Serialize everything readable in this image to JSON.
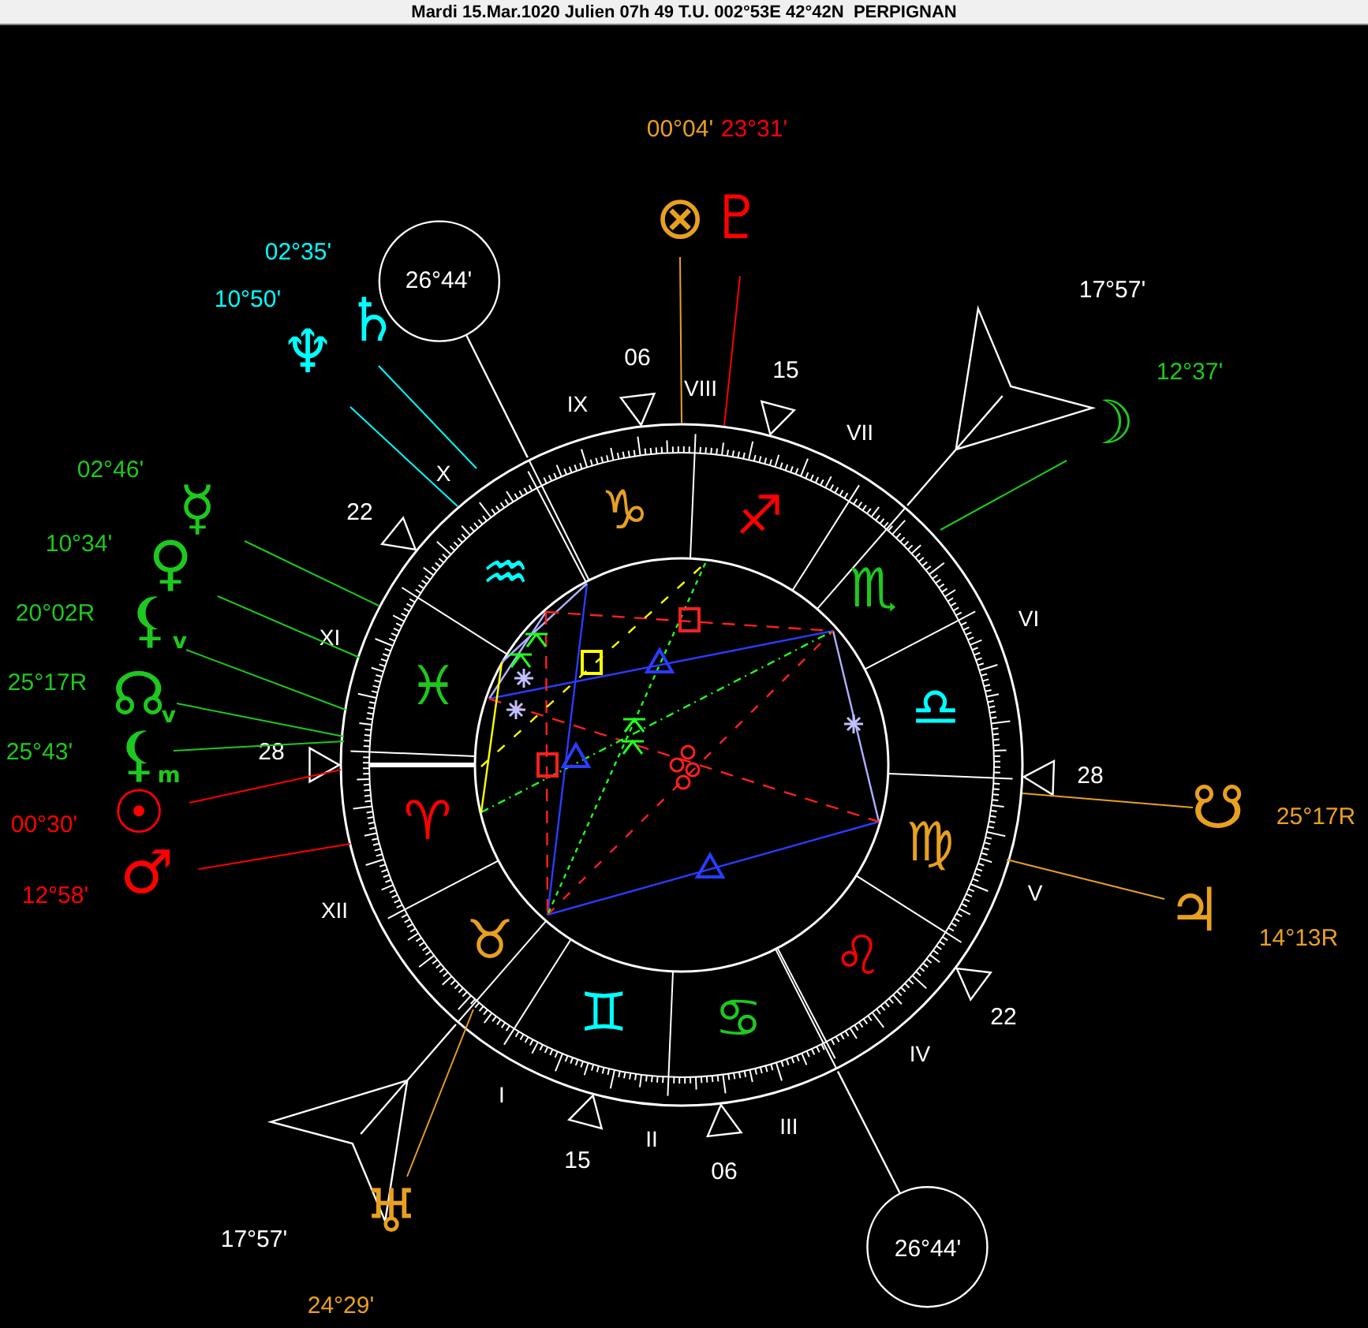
{
  "title_bar": {
    "title": "Mardi 15.Mar.1020 Julien 07h 49 T.U. 002°53E 42°42N  PERPIGNAN"
  },
  "zodiac_signs": [
    {
      "glyph": "♈",
      "color": "#ff0000"
    },
    {
      "glyph": "♉",
      "color": "#e8a020"
    },
    {
      "glyph": "♊",
      "color": "#00ffff"
    },
    {
      "glyph": "♋",
      "color": "#1ec81e"
    },
    {
      "glyph": "♌",
      "color": "#ff0000"
    },
    {
      "glyph": "♍",
      "color": "#e8a020"
    },
    {
      "glyph": "♎",
      "color": "#00ffff"
    },
    {
      "glyph": "♏",
      "color": "#1ec81e"
    },
    {
      "glyph": "♐",
      "color": "#ff0000"
    },
    {
      "glyph": "♑",
      "color": "#e8a020"
    },
    {
      "glyph": "♒",
      "color": "#00ffff"
    },
    {
      "glyph": "♓",
      "color": "#1ec81e"
    }
  ],
  "house_cusps": [
    {
      "numeral": "X",
      "degree": "26°44'",
      "kind": "circle"
    },
    {
      "numeral": "VII",
      "degree": "17°57'",
      "kind": "arrow"
    },
    {
      "numeral": "IX",
      "degree": "06",
      "kind": "triangle"
    },
    {
      "numeral": "VIII",
      "degree": "15",
      "kind": "triangle"
    },
    {
      "numeral": "XI",
      "degree": "22",
      "kind": "triangle"
    },
    {
      "numeral": "VI",
      "degree": "28",
      "kind": "triangle"
    },
    {
      "numeral": "XII",
      "degree": "28",
      "kind": "triangle"
    },
    {
      "numeral": "V",
      "degree": "22",
      "kind": "triangle"
    },
    {
      "numeral": "I",
      "degree": "17°57'",
      "kind": "arrow"
    },
    {
      "numeral": "II",
      "degree": "15",
      "kind": "triangle"
    },
    {
      "numeral": "III",
      "degree": "06",
      "kind": "triangle"
    },
    {
      "numeral": "IV",
      "degree": "26°44'",
      "kind": "circle"
    }
  ],
  "planets": [
    {
      "glyph": "⊗",
      "position": "00°04'",
      "color": "#e8a020"
    },
    {
      "glyph": "♇",
      "position": "23°31'",
      "color": "#ff0000"
    },
    {
      "glyph": "♄",
      "position": "02°35'",
      "color": "#00ffff"
    },
    {
      "glyph": "♆",
      "position": "10°50'",
      "color": "#00ffff"
    },
    {
      "glyph": "☽",
      "position": "12°37'",
      "color": "#1ec81e"
    },
    {
      "glyph": "☿",
      "position": "02°46'",
      "color": "#1ec81e"
    },
    {
      "glyph": "♀",
      "position": "10°34'",
      "color": "#1ec81e"
    },
    {
      "glyph": "⚸",
      "suffix": "v",
      "position": "20°02R",
      "color": "#1ec81e"
    },
    {
      "glyph": "☊",
      "suffix": "v",
      "position": "25°17R",
      "color": "#1ec81e"
    },
    {
      "glyph": "⚸",
      "suffix": "m",
      "position": "25°43'",
      "color": "#1ec81e"
    },
    {
      "glyph": "☉",
      "position": "00°30'",
      "color": "#ff0000"
    },
    {
      "glyph": "♂",
      "position": "12°58'",
      "color": "#ff0000"
    },
    {
      "glyph": "♅",
      "position": "24°29'",
      "color": "#e8a020"
    },
    {
      "glyph": "☋",
      "position": "25°17R",
      "color": "#e8a020"
    },
    {
      "glyph": "♃",
      "position": "14°13R",
      "color": "#e8a020"
    }
  ]
}
